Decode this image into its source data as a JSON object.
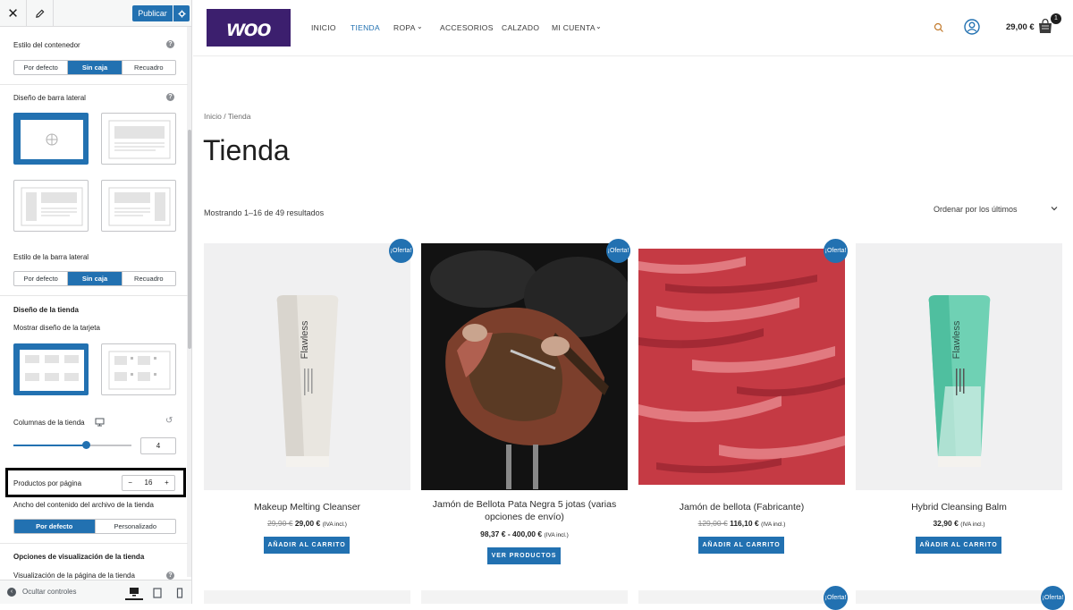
{
  "customizer": {
    "publish_label": "Publicar",
    "container_style": {
      "label": "Estilo del contenedor",
      "options": [
        "Por defecto",
        "Sin caja",
        "Recuadro"
      ],
      "selected": "Sin caja"
    },
    "sidebar_design": {
      "label": "Diseño de barra lateral"
    },
    "sidebar_style": {
      "label": "Estilo de la barra lateral",
      "options": [
        "Por defecto",
        "Sin caja",
        "Recuadro"
      ],
      "selected": "Sin caja"
    },
    "shop_design": {
      "heading": "Diseño de la tienda",
      "card_label": "Mostrar diseño de la tarjeta"
    },
    "columns": {
      "label": "Columnas de la tienda",
      "value": "4"
    },
    "per_page": {
      "label": "Productos por página",
      "value": "16",
      "minus": "−",
      "plus": "+"
    },
    "archive_width": {
      "label": "Ancho del contenido del archivo de la tienda",
      "options": [
        "Por defecto",
        "Personalizado"
      ],
      "selected": "Por defecto"
    },
    "display_options": {
      "heading": "Opciones de visualización de la tienda",
      "page_view_label": "Visualización de la página de la tienda"
    },
    "footer": {
      "hide_label": "Ocultar controles"
    }
  },
  "site": {
    "logo_text": "woo",
    "nav": [
      "INICIO",
      "TIENDA",
      "ROPA",
      "ACCESORIOS",
      "CALZADO",
      "MI CUENTA"
    ],
    "active_nav": "TIENDA",
    "cart_total": "29,00 €",
    "cart_count": "1",
    "breadcrumb": "Inicio / Tienda",
    "page_title": "Tienda",
    "result_count": "Mostrando 1–16 de 49 resultados",
    "ordering": "Ordenar por los últimos",
    "onsale_label": "¡Oferta!",
    "products": [
      {
        "name": "Makeup Melting Cleanser",
        "old_price": "29,90 €",
        "price": "29,00 €",
        "tax": "(IVA incl.)",
        "button": "AÑADIR AL CARRITO",
        "on_sale": true,
        "brand": "Flawless"
      },
      {
        "name": "Jamón de Bellota Pata Negra 5 jotas (varias opciones de envío)",
        "old_price": "",
        "price": "98,37 € - 400,00 €",
        "tax": "(IVA incl.)",
        "button": "VER PRODUCTOS",
        "on_sale": true
      },
      {
        "name": "Jamón de bellota (Fabricante)",
        "old_price": "129,00 €",
        "price": "116,10 €",
        "tax": "(IVA incl.)",
        "button": "AÑADIR AL CARRITO",
        "on_sale": true
      },
      {
        "name": "Hybrid Cleansing Balm",
        "old_price": "",
        "price": "32,90 €",
        "tax": "(IVA incl.)",
        "button": "AÑADIR AL CARRITO",
        "on_sale": false,
        "brand": "Flawless"
      }
    ]
  },
  "colors": {
    "accent": "#2271b1",
    "logo_bg": "#3c1f6e"
  }
}
